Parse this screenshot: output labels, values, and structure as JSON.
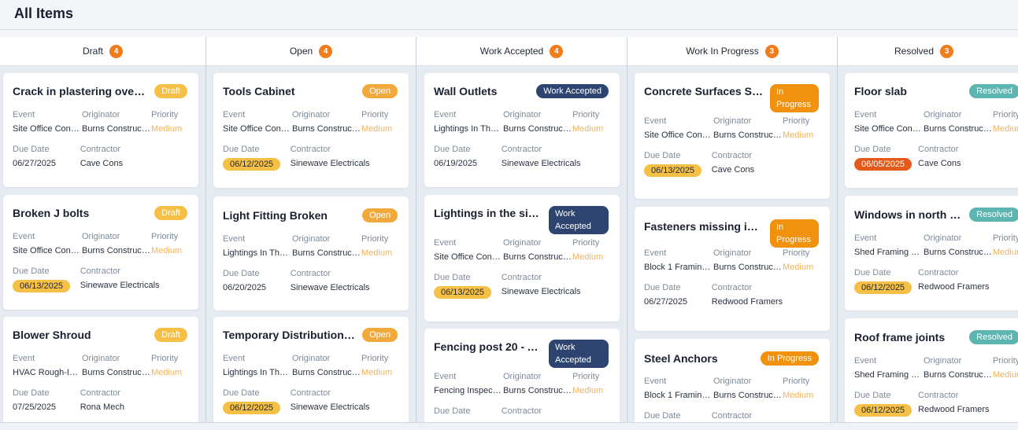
{
  "page": {
    "title": "All Items"
  },
  "labels": {
    "event": "Event",
    "originator": "Originator",
    "priority": "Priority",
    "due_date": "Due Date",
    "contractor": "Contractor"
  },
  "columns": [
    {
      "name": "Draft",
      "count": "4"
    },
    {
      "name": "Open",
      "count": "4"
    },
    {
      "name": "Work Accepted",
      "count": "4"
    },
    {
      "name": "Work In Progress",
      "count": "3"
    },
    {
      "name": "Resolved",
      "count": "3"
    }
  ],
  "cards": [
    [
      {
        "title": "Crack in plastering over ...",
        "status": "Draft",
        "event": "Site Office Conc...",
        "originator": "Burns Construct...",
        "priority": "Medium",
        "due_date": "06/27/2025",
        "contractor": "Cave Cons"
      },
      {
        "title": "Broken J bolts",
        "status": "Draft",
        "event": "Site Office Const...",
        "originator": "Burns Construct...",
        "priority": "Medium",
        "due_date": "06/13/2025",
        "contractor": "Sinewave Electricals"
      },
      {
        "title": "Blower Shroud",
        "status": "Draft",
        "event": "HVAC Rough-In ...",
        "originator": "Burns Construct...",
        "priority": "Medium",
        "due_date": "07/25/2025",
        "contractor": "Rona Mech"
      }
    ],
    [
      {
        "title": "Tools Cabinet",
        "status": "Open",
        "event": "Site Office Const...",
        "originator": "Burns Construct...",
        "priority": "Medium",
        "due_date": "06/12/2025",
        "contractor": "Sinewave Electricals"
      },
      {
        "title": "Light Fitting Broken",
        "status": "Open",
        "event": "Lightings In The ...",
        "originator": "Burns Construct...",
        "priority": "Medium",
        "due_date": "06/20/2025",
        "contractor": "Sinewave Electricals"
      },
      {
        "title": "Temporary Distribution ...",
        "status": "Open",
        "event": "Lightings In The ...",
        "originator": "Burns Construct...",
        "priority": "Medium",
        "due_date": "06/12/2025",
        "contractor": "Sinewave Electricals"
      }
    ],
    [
      {
        "title": "Wall Outlets",
        "status": "Work Accepted",
        "event": "Lightings In The ...",
        "originator": "Burns Construct...",
        "priority": "Medium",
        "due_date": "06/19/2025",
        "contractor": "Sinewave Electricals"
      },
      {
        "title": "Lightings in the site...",
        "status": "Work Accepted",
        "event": "Site Office Const...",
        "originator": "Burns Construct...",
        "priority": "Medium",
        "due_date": "06/13/2025",
        "contractor": "Sinewave Electricals"
      },
      {
        "title": "Fencing post 20 - A...",
        "status": "Work Accepted",
        "event": "Fencing Inspecti...",
        "originator": "Burns Construct...",
        "priority": "Medium",
        "due_date": "",
        "contractor": ""
      }
    ],
    [
      {
        "title": "Concrete Surfaces Se...",
        "status": "In Progress",
        "event": "Site Office Conc...",
        "originator": "Burns Construct...",
        "priority": "Medium",
        "due_date": "06/13/2025",
        "contractor": "Cave Cons"
      },
      {
        "title": "Fasteners missing in s...",
        "status": "In Progress",
        "event": "Block 1 Framing ...",
        "originator": "Burns Construct...",
        "priority": "Medium",
        "due_date": "06/27/2025",
        "contractor": "Redwood Framers"
      },
      {
        "title": "Steel Anchors",
        "status": "In Progress",
        "event": "Block 1 Framing ...",
        "originator": "Burns Construct...",
        "priority": "Medium",
        "due_date": "",
        "contractor": ""
      }
    ],
    [
      {
        "title": "Floor slab",
        "status": "Resolved",
        "event": "Site Office Conc...",
        "originator": "Burns Construct...",
        "priority": "Medium",
        "due_date": "06/05/2025",
        "contractor": "Cave Cons"
      },
      {
        "title": "Windows in north wall",
        "status": "Resolved",
        "event": "Shed Framing W...",
        "originator": "Burns Construct...",
        "priority": "Medium",
        "due_date": "06/12/2025",
        "contractor": "Redwood Framers"
      },
      {
        "title": "Roof frame joints",
        "status": "Resolved",
        "event": "Shed Framing W...",
        "originator": "Burns Construct...",
        "priority": "Medium",
        "due_date": "06/12/2025",
        "contractor": "Redwood Framers"
      }
    ]
  ],
  "colors": {
    "count_badge": "#f07c1c",
    "draft": "#f5c045",
    "open": "#f2a93b",
    "accepted": "#2d4470",
    "in_progress": "#f0920e",
    "resolved": "#5cb5b0",
    "overdue": "#e45a1a"
  }
}
